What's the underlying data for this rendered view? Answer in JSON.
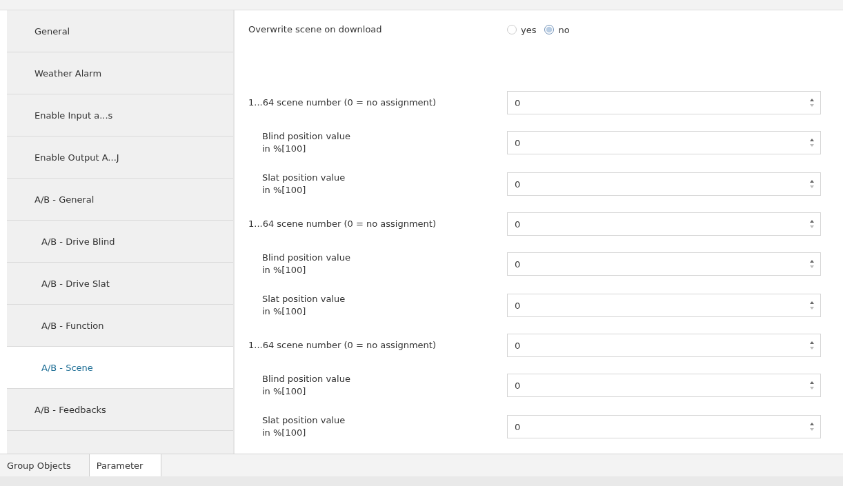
{
  "sidebar": {
    "items": [
      {
        "label": "General",
        "selected": false
      },
      {
        "label": "Weather Alarm",
        "selected": false
      },
      {
        "label": "Enable Input a...s",
        "selected": false
      },
      {
        "label": "Enable Output A...J",
        "selected": false
      },
      {
        "label": "A/B - General",
        "selected": false,
        "children": [
          {
            "label": "A/B - Drive Blind",
            "selected": false
          },
          {
            "label": "A/B - Drive Slat",
            "selected": false
          },
          {
            "label": "A/B - Function",
            "selected": false
          },
          {
            "label": "A/B - Scene",
            "selected": true
          }
        ]
      },
      {
        "label": "A/B - Feedbacks",
        "selected": false
      }
    ]
  },
  "parameters": [
    {
      "kind": "radio",
      "label": "Overwrite scene on download",
      "options": [
        {
          "label": "yes",
          "selected": false
        },
        {
          "label": "no",
          "selected": true
        }
      ]
    },
    {
      "kind": "number",
      "indented": false,
      "label": "1...64 scene number (0 = no assignment)",
      "value": "0"
    },
    {
      "kind": "number",
      "indented": true,
      "label": "Blind position value\nin %[100]",
      "value": "0"
    },
    {
      "kind": "number",
      "indented": true,
      "label": "Slat position value\nin %[100]",
      "value": "0"
    },
    {
      "kind": "number",
      "indented": false,
      "label": "1...64 scene number  (0 = no assignment)",
      "value": "0"
    },
    {
      "kind": "number",
      "indented": true,
      "label": "Blind position value\nin %[100]",
      "value": "0"
    },
    {
      "kind": "number",
      "indented": true,
      "label": "Slat position value\nin %[100]",
      "value": "0"
    },
    {
      "kind": "number",
      "indented": false,
      "label": "1...64 scene number (0 = no assignment)",
      "value": "0"
    },
    {
      "kind": "number",
      "indented": true,
      "label": "Blind position value\nin %[100]",
      "value": "0"
    },
    {
      "kind": "number",
      "indented": true,
      "label": "Slat position value\nin %[100]",
      "value": "0"
    }
  ],
  "tabs": [
    {
      "label": "Group Objects",
      "selected": false
    },
    {
      "label": "Parameter",
      "selected": true
    }
  ]
}
